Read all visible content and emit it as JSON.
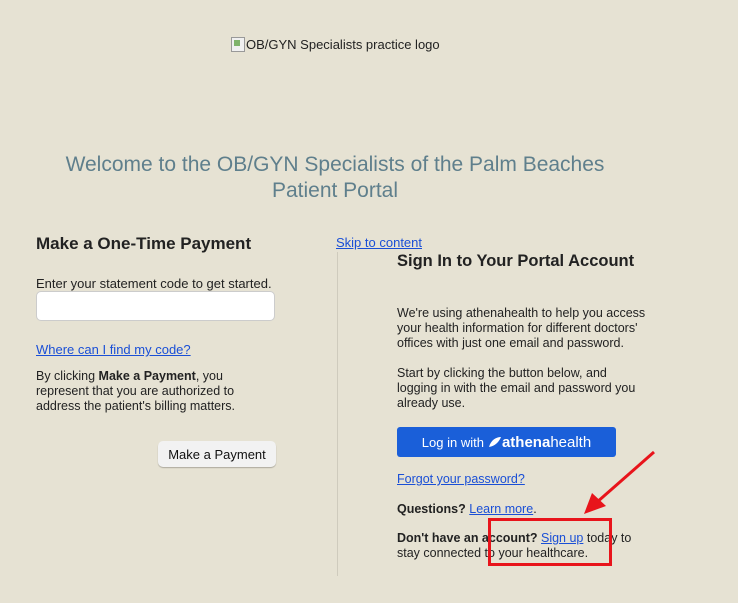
{
  "logo": {
    "alt_text": "OB/GYN Specialists practice logo"
  },
  "welcome": {
    "line1": "Welcome to the OB/GYN Specialists of the Palm Beaches",
    "line2": "Patient Portal"
  },
  "payment": {
    "title": "Make a One-Time Payment",
    "hint": "Enter your statement code to get started.",
    "input_value": "",
    "find_code_link": "Where can I find my code?",
    "disclaimer_pre": "By clicking ",
    "disclaimer_bold": "Make a Payment",
    "disclaimer_post": ", you represent that you are authorized to address the patient's billing matters.",
    "button": "Make a Payment"
  },
  "skip_link": "Skip to content",
  "signin": {
    "title": "Sign In to Your Portal Account",
    "para1": "We're using athenahealth to help you access your health information for different doctors' offices with just one email and password.",
    "para2": "Start by clicking the button below, and logging in with the email and password you already use.",
    "button_prefix": "Log in with",
    "button_brand_bold": "athena",
    "button_brand_rest": "health",
    "forgot_link": "Forgot your password?",
    "questions_label": "Questions?",
    "learn_more_link": "Learn more",
    "learn_more_after": ".",
    "no_account_label": "Don't have an account?",
    "sign_up_link": "Sign up",
    "sign_up_after": " today to stay connected to your healthcare."
  },
  "annotation": {
    "color": "#e8141b"
  }
}
